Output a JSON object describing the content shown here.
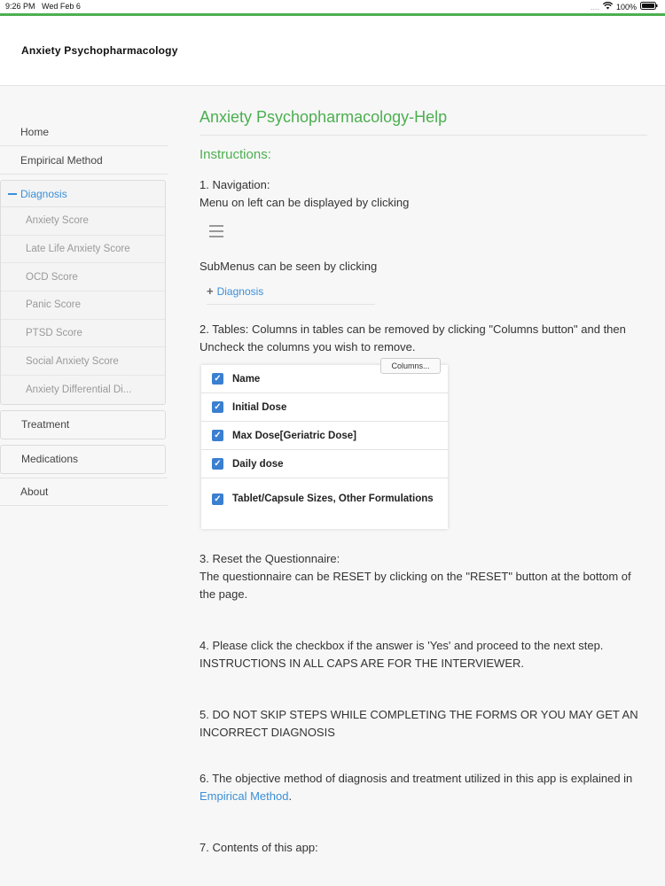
{
  "status": {
    "time": "9:26 PM",
    "date": "Wed Feb 6",
    "battery": "100%",
    "signal": "...."
  },
  "header": {
    "title": "Anxiety Psychopharmacology"
  },
  "sidebar": {
    "home": "Home",
    "empirical": "Empirical Method",
    "diagnosis": {
      "label": "Diagnosis",
      "items": [
        "Anxiety Score",
        "Late Life Anxiety Score",
        "OCD Score",
        "Panic Score",
        "PTSD Score",
        "Social Anxiety Score",
        "Anxiety Differential Di..."
      ]
    },
    "treatment": "Treatment",
    "medications": "Medications",
    "about": "About"
  },
  "main": {
    "title": "Anxiety Psychopharmacology-Help",
    "instructions": "Instructions:",
    "nav_heading": "1. Navigation:",
    "nav_text": "Menu on left can be displayed by clicking",
    "submenu_text": "SubMenus can be seen by clicking",
    "submenu_demo": "Diagnosis",
    "tables_text": "2. Tables: Columns in tables can be removed by clicking \"Columns button\" and then Uncheck the columns you wish to remove.",
    "columns_button": "Columns...",
    "columns": [
      "Name",
      "Initial Dose",
      "Max Dose[Geriatric Dose]",
      "Daily dose",
      "Tablet/Capsule Sizes, Other Formulations"
    ],
    "reset_heading": "3. Reset the Questionnaire:",
    "reset_text": "The questionnaire can be RESET by clicking on the \"RESET\" button at the bottom of the page.",
    "checkbox_text": "4. Please click the checkbox if the answer is 'Yes' and proceed to the next step. INSTRUCTIONS IN ALL CAPS ARE FOR THE INTERVIEWER.",
    "noskip_text": "5. DO NOT SKIP STEPS WHILE COMPLETING THE FORMS OR YOU MAY GET AN INCORRECT DIAGNOSIS",
    "objective_text": "6. The objective method of diagnosis and treatment utilized in this app is explained in",
    "objective_link": "Empirical Method",
    "objective_end": ".",
    "contents_text": "7. Contents of this app:"
  },
  "colors": {
    "accent_green": "#4caf50",
    "link_blue": "#3a8fd8"
  }
}
